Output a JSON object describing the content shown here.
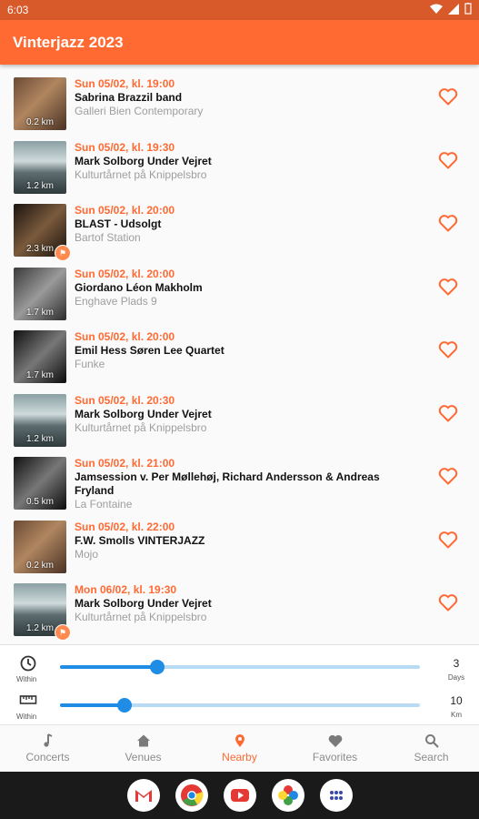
{
  "status": {
    "time": "6:03"
  },
  "app": {
    "title": "Vinterjazz 2023"
  },
  "events": [
    {
      "date": "Sun 05/02, kl. 19:00",
      "name": "Sabrina Brazzil band",
      "venue": "Galleri Bien Contemporary",
      "distance": "0.2 km",
      "thumb": "warm"
    },
    {
      "date": "Sun 05/02, kl. 19:30",
      "name": "Mark Solborg Under Vejret",
      "venue": "Kulturtårnet på Knippelsbro",
      "distance": "1.2 km",
      "thumb": "tower"
    },
    {
      "date": "Sun 05/02, kl. 20:00",
      "name": "BLAST - Udsolgt",
      "venue": "Bartof Station",
      "distance": "2.3 km",
      "thumb": "dark",
      "badge": "⚑"
    },
    {
      "date": "Sun 05/02, kl. 20:00",
      "name": "Giordano Léon Makholm",
      "venue": "Enghave Plads 9",
      "distance": "1.7 km",
      "thumb": "gray"
    },
    {
      "date": "Sun 05/02, kl. 20:00",
      "name": "Emil Hess Søren Lee Quartet",
      "venue": "Funke",
      "distance": "1.7 km",
      "thumb": "bw"
    },
    {
      "date": "Sun 05/02, kl. 20:30",
      "name": "Mark Solborg Under Vejret",
      "venue": "Kulturtårnet på Knippelsbro",
      "distance": "1.2 km",
      "thumb": "tower"
    },
    {
      "date": "Sun 05/02, kl. 21:00",
      "name": "Jamsession v. Per Møllehøj, Richard Andersson & Andreas Fryland",
      "venue": "La Fontaine",
      "distance": "0.5 km",
      "thumb": "bw"
    },
    {
      "date": "Sun 05/02, kl. 22:00",
      "name": "F.W. Smolls VINTERJAZZ",
      "venue": "Mojo",
      "distance": "0.2 km",
      "thumb": "warm"
    },
    {
      "date": "Mon 06/02, kl. 19:30",
      "name": "Mark Solborg Under Vejret",
      "venue": "Kulturtårnet på Knippelsbro",
      "distance": "1.2 km",
      "thumb": "tower",
      "badge": "⚑"
    }
  ],
  "filters": {
    "time": {
      "label": "Within",
      "value": "3",
      "unit": "Days",
      "level": 0.27
    },
    "distance": {
      "label": "Within",
      "value": "10",
      "unit": "Km",
      "level": 0.18
    }
  },
  "nav": [
    {
      "label": "Concerts",
      "icon": "music-note-icon"
    },
    {
      "label": "Venues",
      "icon": "home-icon"
    },
    {
      "label": "Nearby",
      "icon": "location-pin-icon"
    },
    {
      "label": "Favorites",
      "icon": "heart-icon"
    },
    {
      "label": "Search",
      "icon": "search-icon"
    }
  ],
  "colors": {
    "accent": "#ff6a33",
    "slider": "#1f8ce5",
    "statusbar": "#d85a2a"
  }
}
